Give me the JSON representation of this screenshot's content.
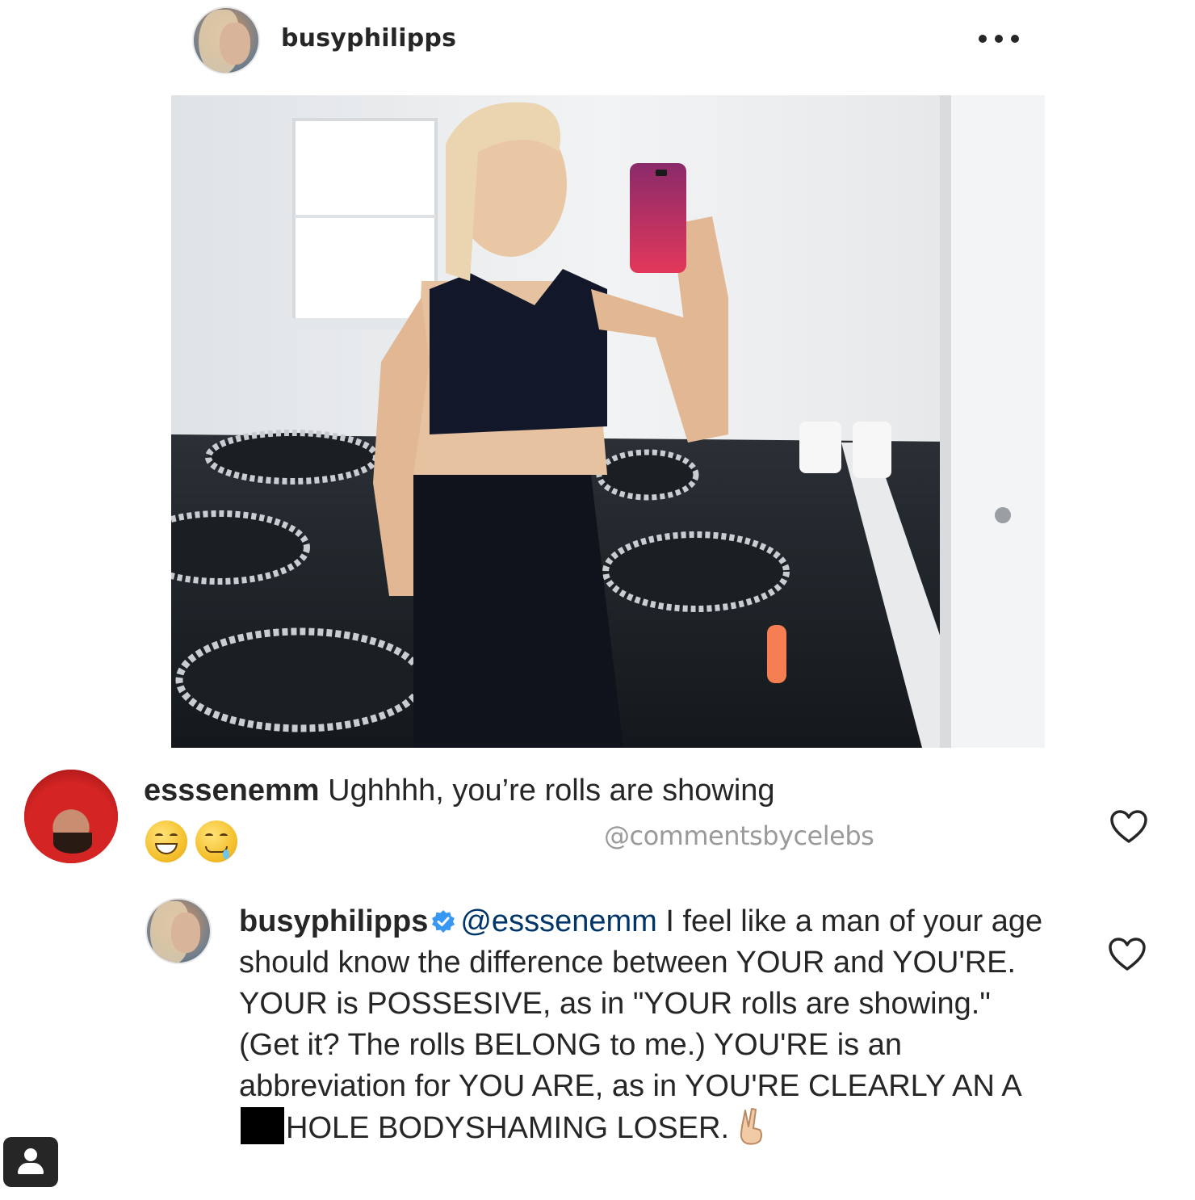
{
  "post": {
    "username": "busyphilipps",
    "more_icon": "more-dots-icon",
    "photo_description_icon": "gym-mirror-selfie-photo"
  },
  "comments": [
    {
      "username": "esssenemm",
      "text": "Ughhhh, you’re rolls are showing",
      "emojis": [
        "grinning-emoji",
        "drooling-emoji"
      ],
      "like_icon": "heart-outline-icon"
    },
    {
      "username": "busyphilipps",
      "verified": true,
      "mention": "@esssenemm",
      "text_part1": "I feel like a man of your age should know the difference between YOUR and YOU'RE. YOUR is POSSESIVE, as in \"YOUR rolls are showing.\" (Get it? The rolls BELONG to me.) YOU'RE is an abbreviation for YOU ARE, as in YOU'RE CLEARLY AN A",
      "text_part2": "HOLE BODYSHAMING LOSER.",
      "end_emoji": "victory-hand-emoji",
      "like_icon": "heart-outline-icon"
    }
  ],
  "watermark": "@commentsbycelebs",
  "colors": {
    "text": "#262626",
    "mention": "#003569",
    "verified": "#3897f0",
    "watermark": "#9a9a9a"
  }
}
